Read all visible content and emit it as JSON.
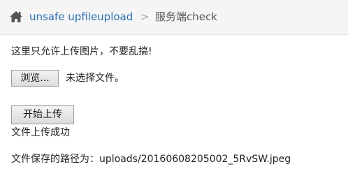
{
  "breadcrumb": {
    "home_icon": "home-icon",
    "link_label": "unsafe upfileupload",
    "separator": ">",
    "current_label": "服务端check",
    "link_color": "#2a6fb1"
  },
  "main": {
    "notice": "这里只允许上传图片，不要乱搞!",
    "browse_label": "浏览...",
    "file_status": "未选择文件。",
    "upload_label": "开始上传",
    "success": "文件上传成功",
    "path": "文件保存的路径为：uploads/20160608205002_5RvSW.jpeg"
  }
}
